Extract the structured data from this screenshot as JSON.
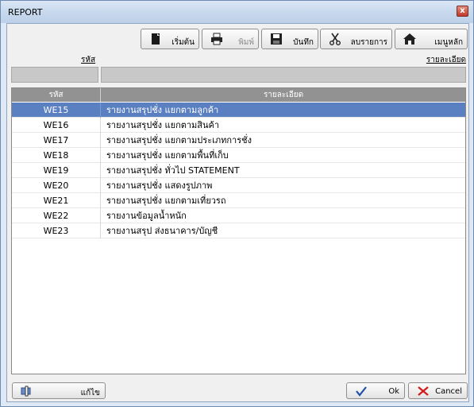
{
  "window": {
    "title": "REPORT",
    "close_glyph": "x"
  },
  "toolbar": {
    "start_label": "เริ่มต้น",
    "print_label": "พิมพ์",
    "save_label": "บันทึก",
    "delete_label": "ลบรายการ",
    "menu_label": "เมนูหลัก"
  },
  "filter": {
    "code_header": "รหัส",
    "detail_header": "รายละเอียด"
  },
  "grid": {
    "columns": [
      "รหัส",
      "รายละเอียด"
    ],
    "rows": [
      {
        "code": "WE15",
        "desc": "รายงานสรุปชั่ง แยกตามลูกค้า"
      },
      {
        "code": "WE16",
        "desc": "รายงานสรุปชั่ง แยกตามสินค้า"
      },
      {
        "code": "WE17",
        "desc": "รายงานสรุปชั่ง แยกตามประเภทการชั่ง"
      },
      {
        "code": "WE18",
        "desc": "รายงานสรุปชั่ง แยกตามพื้นที่เก็บ"
      },
      {
        "code": "WE19",
        "desc": "รายงานสรุปชั่ง ทั่วไป STATEMENT"
      },
      {
        "code": "WE20",
        "desc": "รายงานสรุปชั่ง แสดงรูปภาพ"
      },
      {
        "code": "WE21",
        "desc": "รายงานสรุปชั่ง แยกตามเที่ยวรถ"
      },
      {
        "code": "WE22",
        "desc": "รายงานข้อมูลน้ำหนัก"
      },
      {
        "code": "WE23",
        "desc": "รายงานสรุป ส่งธนาคาร/บัญชี"
      }
    ]
  },
  "footer": {
    "edit_label": "แก้ไข",
    "ok_label": "Ok",
    "cancel_label": "Cancel"
  }
}
